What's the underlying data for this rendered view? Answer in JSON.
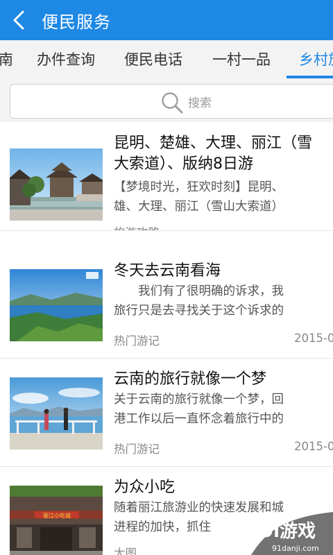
{
  "header": {
    "title": "便民服务"
  },
  "tabs": [
    {
      "label": "南"
    },
    {
      "label": "办件查询"
    },
    {
      "label": "便民电话"
    },
    {
      "label": "一村一品"
    },
    {
      "label": "乡村旅"
    }
  ],
  "search": {
    "placeholder": "搜索"
  },
  "articles": [
    {
      "title_line1": "昆明、楚雄、大理、丽江（雪",
      "title_line2": "大索道）、版纳8日游",
      "desc_line1": "【梦境时光，狂欢时刻】昆明、",
      "desc_line2": "雄、大理、丽江（雪山大索道）",
      "category": "旅游攻略",
      "date": ""
    },
    {
      "title_line1": "冬天去云南看海",
      "desc_line1": "　　我们有了很明确的诉求，我",
      "desc_line2": "旅行只是去寻找关于这个诉求的",
      "category": "热门游记",
      "date": "2015-0"
    },
    {
      "title_line1": "云南的旅行就像一个梦",
      "desc_line1": "关于云南的旅行就像一个梦，回",
      "desc_line2": "港工作以后一直怀念着旅行中的",
      "category": "热门游记",
      "date": "2015-0"
    },
    {
      "title_line1": "为众小吃",
      "desc_line1": "随着丽江旅游业的快速发展和城",
      "desc_line2": "进程的加快，抓住",
      "category": "大图",
      "date": ""
    }
  ],
  "images": {
    "item4_sign": "丽江小吃城"
  },
  "watermark": {
    "brand": "9l游戏",
    "url": "91danji.com"
  },
  "colors": {
    "primary": "#1e88e5",
    "tab_bg": "#f3f3f3"
  }
}
